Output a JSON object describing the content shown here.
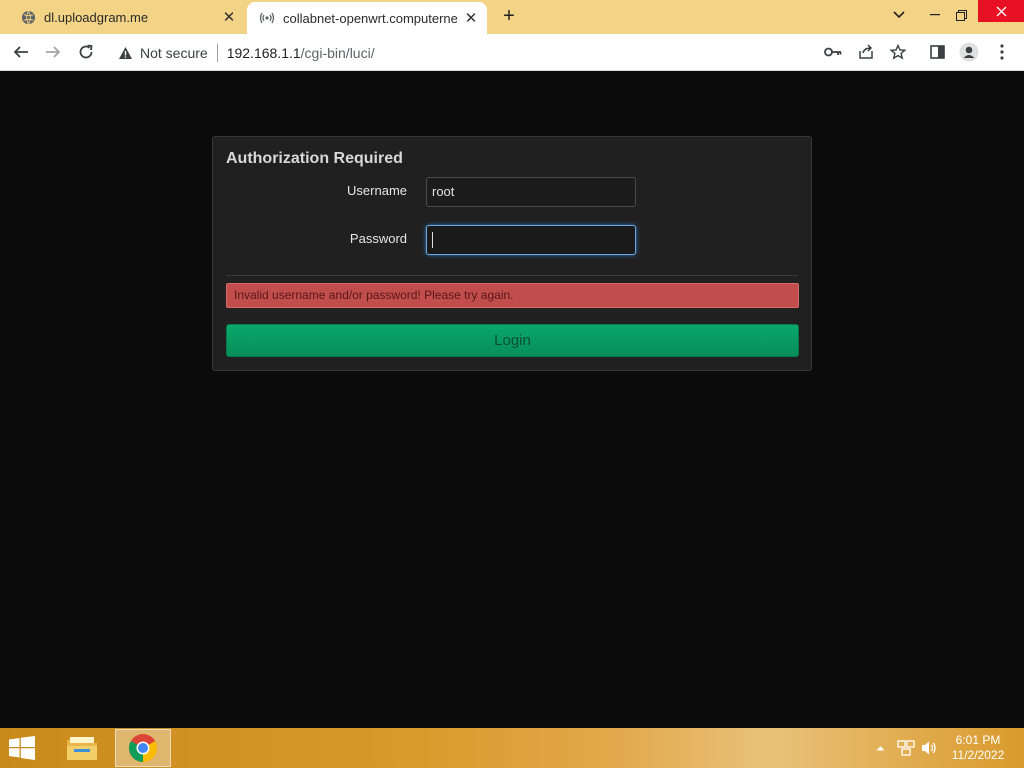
{
  "browser": {
    "tabs": [
      {
        "title": "dl.uploadgram.me",
        "favicon": "globe-icon",
        "active": false
      },
      {
        "title": "collabnet-openwrt.computernew",
        "favicon": "broadcast-icon",
        "active": true
      }
    ],
    "new_tab": "+",
    "security_label": "Not secure",
    "url_host": "192.168.1.1",
    "url_path": "/cgi-bin/luci/"
  },
  "login": {
    "heading": "Authorization Required",
    "username_label": "Username",
    "username_value": "root",
    "password_label": "Password",
    "password_value": "",
    "error": "Invalid username and/or password! Please try again.",
    "button": "Login"
  },
  "colors": {
    "tabstrip": "#f3d386",
    "panel": "#202020",
    "alert": "#c14d4d",
    "login_button": "#0aa86a",
    "close_button": "#e81123"
  },
  "taskbar": {
    "time": "6:01 PM",
    "date": "11/2/2022"
  }
}
